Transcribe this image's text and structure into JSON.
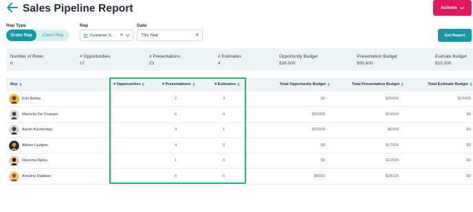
{
  "header": {
    "title": "Sales Pipeline Report",
    "actions_label": "Actions"
  },
  "filters": {
    "rep_type_label": "Rep Type",
    "rep_type_options": [
      "Order Rep",
      "Client Rep"
    ],
    "rep_type_selected": "Order Rep",
    "rep_label": "Rep",
    "rep_value": "Customer S...",
    "date_label": "Date",
    "date_value": "This Year",
    "get_report_label": "Get Report"
  },
  "summary": [
    {
      "label": "Number of Rows",
      "value": "6"
    },
    {
      "label": "# Opportunities",
      "value": "17"
    },
    {
      "label": "# Presentations",
      "value": "23"
    },
    {
      "label": "# Estimates",
      "value": "4"
    },
    {
      "label": "Opportunity Budget",
      "value": "$38,000"
    },
    {
      "label": "Presentation Budget",
      "value": "$95,600"
    },
    {
      "label": "Esimate Budget",
      "value": "$15,000"
    }
  ],
  "table": {
    "columns": [
      "Rep",
      "# Opporunities",
      "# Presentations",
      "# Estimates",
      "Total Opportunity Budget",
      "Total Presentation Budget",
      "Total Estimate Budget"
    ],
    "rows": [
      {
        "rep": "Erin Burley",
        "opportunities": "",
        "presentations": "2",
        "estimates": "3",
        "opp_budget": "$0",
        "pres_budget": "$20000",
        "est_budget": "$15000"
      },
      {
        "rep": "Marcella De Ocampo",
        "opportunities": "",
        "presentations": "6",
        "estimates": "0",
        "opp_budget": "$20000",
        "pres_budget": "$14500",
        "est_budget": "$0"
      },
      {
        "rep": "Aaron Kucherawy",
        "opportunities": "",
        "presentations": "4",
        "estimates": "1",
        "opp_budget": "$10000",
        "pres_budget": "$6000",
        "est_budget": "$0"
      },
      {
        "rep": "Allison Lavigne",
        "opportunities": "",
        "presentations": "4",
        "estimates": "0",
        "opp_budget": "$0",
        "pres_budget": "$17000",
        "est_budget": "$0"
      },
      {
        "rep": "Nneoma Njoku",
        "opportunities": "",
        "presentations": "1",
        "estimates": "0",
        "opp_budget": "$0",
        "pres_budget": "$10000",
        "est_budget": "$0"
      },
      {
        "rep": "Amalina Radwan",
        "opportunities": "",
        "presentations": "6",
        "estimates": "0",
        "opp_budget": "$8000",
        "pres_budget": "$28100",
        "est_budget": "$0"
      }
    ]
  },
  "colors": {
    "accent_teal": "#1a97a6",
    "actions_pink": "#e01a5e",
    "highlight_green": "#1fb36b",
    "remove_red": "#d9262c"
  },
  "icons": [
    "back-arrow-icon",
    "chevron-down-icon",
    "people-icon",
    "clear-icon",
    "sort-icon",
    "avatar"
  ]
}
